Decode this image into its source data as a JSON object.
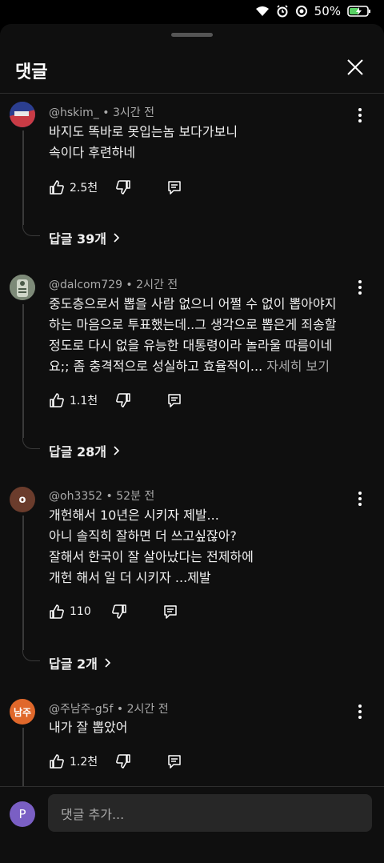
{
  "status_bar": {
    "battery": "50%"
  },
  "sheet": {
    "title": "댓글"
  },
  "comments": [
    {
      "author": "@hskim_",
      "time": "3시간 전",
      "lines": [
        "바지도 똑바로 못입는놈 보다가보니",
        "속이다 후련하네"
      ],
      "likes": "2.5천",
      "replies": "답글 39개",
      "avatar_color": "#a83a4a"
    },
    {
      "author": "@dalcom729",
      "time": "2시간 전",
      "lines": [
        "중도층으로서 뽑을 사람 없으니 어쩔 수 없이 뽑아야지",
        "하는 마음으로 투표했는데..그 생각으로 뽑은게 죄송할",
        "정도로 다시 없을 유능한 대통령이라 놀라울 따름이네",
        "요;; 좀 충격적으로 성실하고 효율적이..."
      ],
      "more": "자세히 보기",
      "likes": "1.1천",
      "replies": "답글 28개",
      "avatar_color": "#6f7a6c"
    },
    {
      "author": "@oh3352",
      "time": "52분 전",
      "lines": [
        "개헌해서 10년은 시키자 제발...",
        "아니 솔직히 잘하면 더 쓰고싶잖아?",
        "잘해서 한국이 잘 살아났다는 전제하에",
        "개헌 해서 일 더 시키자 ...제발"
      ],
      "likes": "110",
      "replies": "답글 2개",
      "avatar_letter": "o",
      "avatar_color": "#6b3c2c"
    },
    {
      "author": "@주남주-g5f",
      "time": "2시간 전",
      "lines": [
        "내가 잘 뽑았어"
      ],
      "likes": "1.2천",
      "avatar_letter": "남주",
      "avatar_color": "#e0682b"
    }
  ],
  "composer": {
    "avatar_letter": "P",
    "placeholder": "댓글 추가..."
  },
  "icons": {
    "close": "close-icon",
    "kebab": "more-vert-icon",
    "like": "thumb-up-icon",
    "dislike": "thumb-down-icon",
    "reply": "reply-icon",
    "chevron": "chevron-right-icon"
  }
}
